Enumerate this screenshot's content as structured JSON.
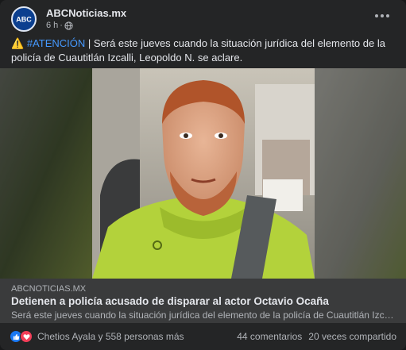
{
  "post": {
    "author": "ABCNoticias.mx",
    "avatar_text": "ABC",
    "time": "6 h",
    "separator": "·",
    "privacy_icon": "globe-icon",
    "warning_emoji": "⚠️",
    "hashtag": "#ATENCIÓN",
    "body": " | Será este jueves cuando la situación jurídica del elemento de la policía de Cuautitlán Izcalli, Leopoldo N. se aclare."
  },
  "link": {
    "domain": "ABCNOTICIAS.MX",
    "headline": "Detienen a policía acusado de disparar al actor Octavio Ocaña",
    "description": "Será este jueves cuando la situación jurídica del elemento de la policía de Cuautitlán Izcalli ..."
  },
  "stats": {
    "reaction_icons": [
      "like-icon",
      "love-icon"
    ],
    "reactions_text": "Chetios Ayala y 558 personas más",
    "comments": "44 comentarios",
    "shares": "20 veces compartido"
  },
  "colors": {
    "card": "#242526",
    "link_card": "#3a3b3c",
    "hashtag": "#4599ff",
    "like": "#1877f2",
    "love": "#f33e58"
  }
}
